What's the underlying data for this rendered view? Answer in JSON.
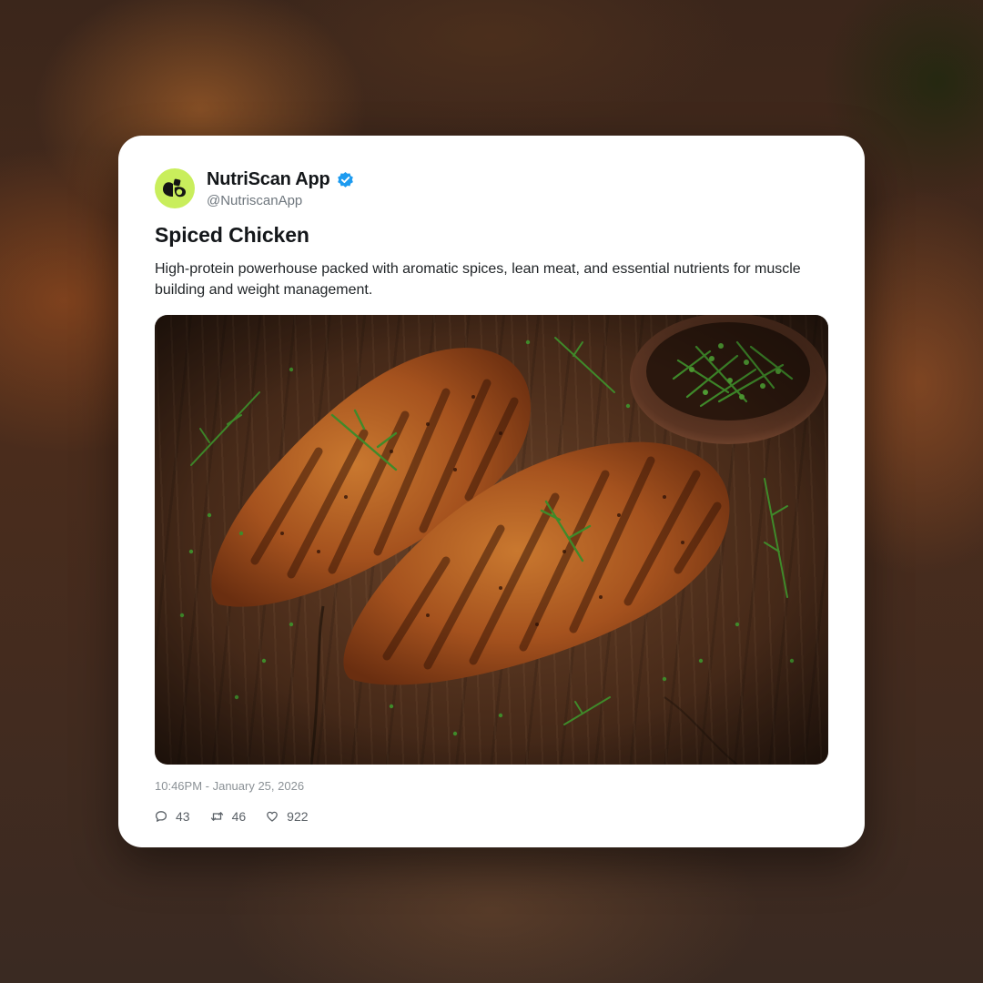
{
  "post": {
    "author_name": "NutriScan App",
    "author_handle": "@NutriscanApp",
    "verified": true,
    "title": "Spiced Chicken",
    "description": "High-protein powerhouse packed with aromatic spices, lean meat, and essential nutrients for muscle building and weight management.",
    "image_alt": "spiced-chicken-photo",
    "timestamp": "10:46PM - January 25, 2026",
    "stats": {
      "replies": "43",
      "reposts": "46",
      "likes": "922"
    }
  },
  "icons": {
    "avatar": "nutriscan-logo-icon",
    "verified": "verified-badge-icon",
    "reply": "comment-icon",
    "repost": "repost-icon",
    "like": "heart-icon"
  },
  "colors": {
    "avatar_bg": "#c9ee5c",
    "verified_blue": "#1d9bf0",
    "text_primary": "#14171a",
    "text_secondary": "#6e767d"
  }
}
